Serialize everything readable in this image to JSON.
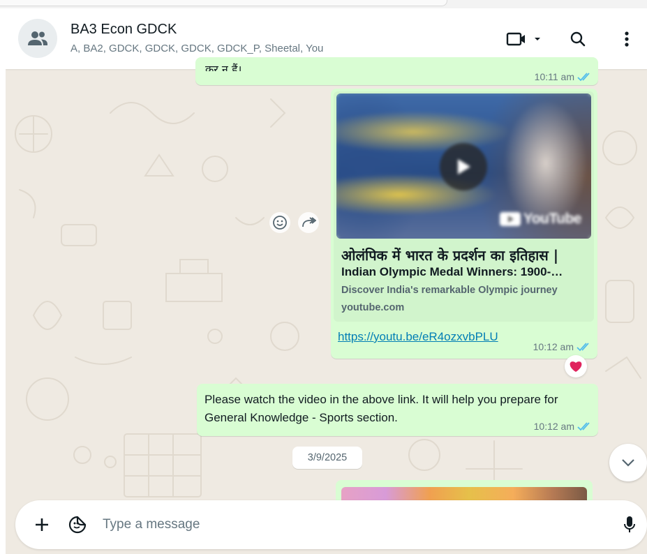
{
  "header": {
    "title": "BA3 Econ GDCK",
    "members": "A, BA2, GDCK, GDCK, GDCK, GDCK_P, Sheetal, You",
    "icons": [
      "group-avatar-icon",
      "video-call-icon",
      "chevron-down-icon",
      "search-icon",
      "more-options-icon"
    ]
  },
  "messages": {
    "top": {
      "partial_text": "कर न हैं।",
      "time": "10:11 am"
    },
    "link": {
      "title_hindi": "ओलंपिक में भारत के प्रदर्शन का इतिहास |",
      "title_english": "Indian Olympic Medal Winners: 1900-…",
      "description": "Discover India's remarkable Olympic journey",
      "domain": "youtube.com",
      "url": "https://youtu.be/eR4ozxvbPLU",
      "time": "10:12 am",
      "reaction": "❤️",
      "thumbnail_brand": "YouTube"
    },
    "text": {
      "body": "Please watch the video in the above link. It will help you prepare for General Knowledge - Sports section.",
      "time": "10:12 am"
    },
    "date_divider": "3/9/2025"
  },
  "composer": {
    "placeholder": "Type a message"
  },
  "colors": {
    "outgoing_bubble": "#d9fdd3",
    "chat_background": "#efeae2",
    "read_ticks": "#53bdeb",
    "link": "#027eb5"
  }
}
